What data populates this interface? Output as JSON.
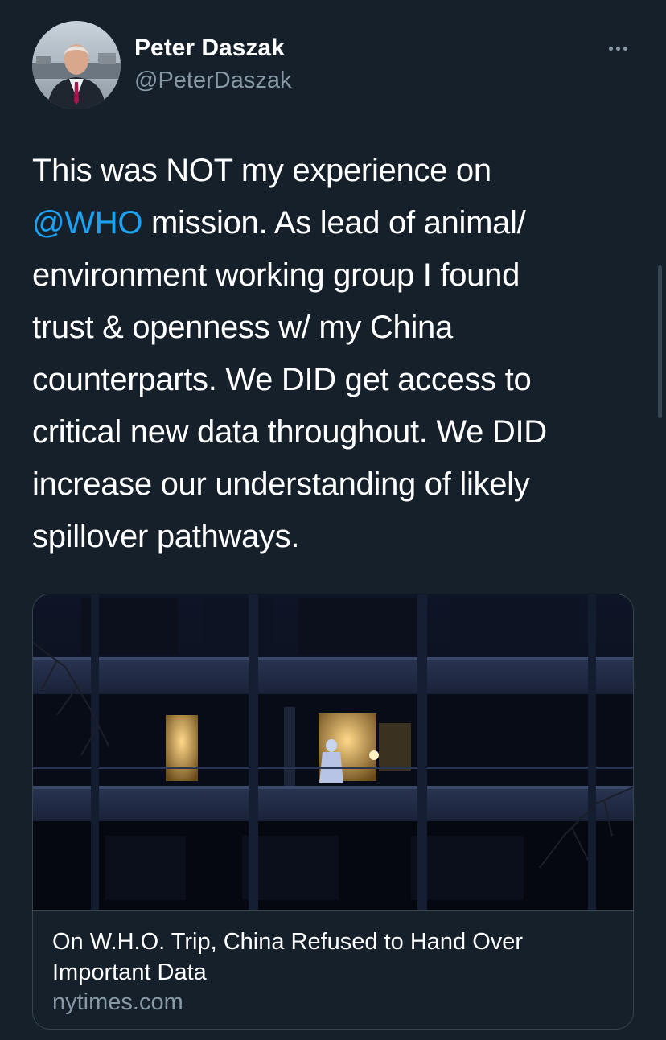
{
  "author": {
    "display_name": "Peter Daszak",
    "handle": "@PeterDaszak",
    "avatar_icon": "profile-photo"
  },
  "menu": {
    "more_icon": "more-horizontal-icon"
  },
  "tweet": {
    "lines": [
      [
        "This was NOT my experience on"
      ],
      [
        "@WHO",
        " mission. As lead of animal/"
      ],
      [
        "environment working group I found"
      ],
      [
        "trust & openness w/ my China"
      ],
      [
        "counterparts. We DID get access to"
      ],
      [
        "critical new data throughout. We DID"
      ],
      [
        "increase our understanding of likely"
      ],
      [
        "spillover pathways."
      ]
    ],
    "mention": "@WHO"
  },
  "card": {
    "title": "On W.H.O. Trip, China Refused to Hand Over Important Data",
    "domain": "nytimes.com",
    "image_description_icon": "night-building-photo"
  },
  "colors": {
    "background": "#15202b",
    "text": "#ffffff",
    "secondary": "#8899a6",
    "link": "#1da1f2",
    "border": "#38444d"
  }
}
